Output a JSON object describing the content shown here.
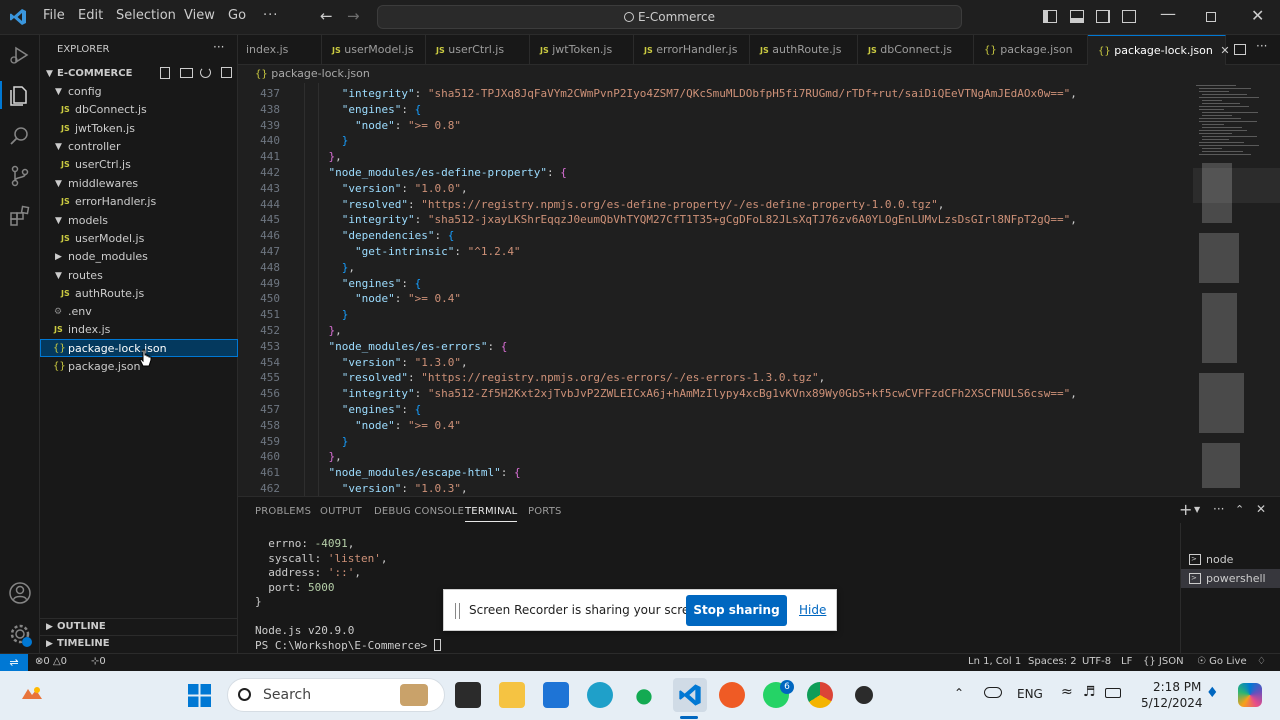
{
  "menu": {
    "file": "File",
    "edit": "Edit",
    "selection": "Selection",
    "view": "View",
    "go": "Go",
    "more": "···"
  },
  "command_center": {
    "label": "E-Commerce"
  },
  "explorer": {
    "title": "EXPLORER",
    "project": "E-COMMERCE",
    "items": [
      {
        "label": "config",
        "type": "folder"
      },
      {
        "label": "dbConnect.js",
        "type": "js"
      },
      {
        "label": "jwtToken.js",
        "type": "js"
      },
      {
        "label": "controller",
        "type": "folder"
      },
      {
        "label": "userCtrl.js",
        "type": "js"
      },
      {
        "label": "middlewares",
        "type": "folder"
      },
      {
        "label": "errorHandler.js",
        "type": "js"
      },
      {
        "label": "models",
        "type": "folder"
      },
      {
        "label": "userModel.js",
        "type": "js"
      },
      {
        "label": "node_modules",
        "type": "folder"
      },
      {
        "label": "routes",
        "type": "folder"
      },
      {
        "label": "authRoute.js",
        "type": "js"
      },
      {
        "label": ".env",
        "type": "env"
      },
      {
        "label": "index.js",
        "type": "js"
      },
      {
        "label": "package-lock.json",
        "type": "json"
      },
      {
        "label": "package.json",
        "type": "json"
      }
    ],
    "outline": "OUTLINE",
    "timeline": "TIMELINE"
  },
  "tabs": [
    {
      "label": "index.js",
      "icon": "JS"
    },
    {
      "label": "userModel.js",
      "icon": "JS"
    },
    {
      "label": "userCtrl.js",
      "icon": "JS"
    },
    {
      "label": "jwtToken.js",
      "icon": "JS"
    },
    {
      "label": "errorHandler.js",
      "icon": "JS"
    },
    {
      "label": "authRoute.js",
      "icon": "JS"
    },
    {
      "label": "dbConnect.js",
      "icon": "JS"
    },
    {
      "label": "package.json",
      "icon": "{}"
    },
    {
      "label": "package-lock.json",
      "icon": "{}"
    }
  ],
  "breadcrumb": "package-lock.json",
  "editor_lines": [
    {
      "n": "437",
      "t": "      \"integrity\": \"sha512-TPJXq8JqFaVYm2CWmPvnP2Iyo4ZSM7/QKcSmuMLDObfpH5fi7RUGmd/rTDf+rut/saiDiQEeVTNgAmJEdAOx0w==\","
    },
    {
      "n": "438",
      "t": "      \"engines\": {"
    },
    {
      "n": "439",
      "t": "        \"node\": \">= 0.8\""
    },
    {
      "n": "440",
      "t": "      }"
    },
    {
      "n": "441",
      "t": "    },"
    },
    {
      "n": "442",
      "t": "    \"node_modules/es-define-property\": {"
    },
    {
      "n": "443",
      "t": "      \"version\": \"1.0.0\","
    },
    {
      "n": "444",
      "t": "      \"resolved\": \"https://registry.npmjs.org/es-define-property/-/es-define-property-1.0.0.tgz\","
    },
    {
      "n": "445",
      "t": "      \"integrity\": \"sha512-jxayLKShrEqqzJ0eumQbVhTYQM27CfT1T35+gCgDFoL82JLsXqTJ76zv6A0YLOgEnLUMvLzsDsGIrl8NFpT2gQ==\","
    },
    {
      "n": "446",
      "t": "      \"dependencies\": {"
    },
    {
      "n": "447",
      "t": "        \"get-intrinsic\": \"^1.2.4\""
    },
    {
      "n": "448",
      "t": "      },"
    },
    {
      "n": "449",
      "t": "      \"engines\": {"
    },
    {
      "n": "450",
      "t": "        \"node\": \">= 0.4\""
    },
    {
      "n": "451",
      "t": "      }"
    },
    {
      "n": "452",
      "t": "    },"
    },
    {
      "n": "453",
      "t": "    \"node_modules/es-errors\": {"
    },
    {
      "n": "454",
      "t": "      \"version\": \"1.3.0\","
    },
    {
      "n": "455",
      "t": "      \"resolved\": \"https://registry.npmjs.org/es-errors/-/es-errors-1.3.0.tgz\","
    },
    {
      "n": "456",
      "t": "      \"integrity\": \"sha512-Zf5H2Kxt2xjTvbJvP2ZWLEICxA6j+hAmMzIlypy4xcBg1vKVnx89Wy0GbS+kf5cwCVFFzdCFh2XSCFNULS6csw==\","
    },
    {
      "n": "457",
      "t": "      \"engines\": {"
    },
    {
      "n": "458",
      "t": "        \"node\": \">= 0.4\""
    },
    {
      "n": "459",
      "t": "      }"
    },
    {
      "n": "460",
      "t": "    },"
    },
    {
      "n": "461",
      "t": "    \"node_modules/escape-html\": {"
    },
    {
      "n": "462",
      "t": "      \"version\": \"1.0.3\","
    }
  ],
  "panel": {
    "tabs": [
      "PROBLEMS",
      "OUTPUT",
      "DEBUG CONSOLE",
      "TERMINAL",
      "PORTS"
    ],
    "terminal_lines": [
      {
        "label": "  errno: ",
        "value": "-4091",
        "end": ",",
        "kind": "num"
      },
      {
        "label": "  syscall: ",
        "value": "'listen'",
        "end": ",",
        "kind": "str"
      },
      {
        "label": "  address: ",
        "value": "'::'",
        "end": ",",
        "kind": "str"
      },
      {
        "label": "  port: ",
        "value": "5000",
        "end": "",
        "kind": "num"
      },
      {
        "label": "}",
        "value": "",
        "end": "",
        "kind": "plain"
      },
      {
        "label": "",
        "value": "",
        "end": "",
        "kind": "plain"
      },
      {
        "label": "Node.js v20.9.0",
        "value": "",
        "end": "",
        "kind": "plain"
      },
      {
        "label": "PS C:\\Workshop\\E-Commerce> ",
        "value": "",
        "end": "",
        "kind": "plain"
      }
    ],
    "terminals": [
      "node",
      "powershell"
    ]
  },
  "share_bar": {
    "message": "Screen Recorder is sharing your screen.",
    "stop": "Stop sharing",
    "hide": "Hide"
  },
  "status": {
    "problems_errors": "0",
    "problems_warnings": "0",
    "ports": "0",
    "position": "Ln 1, Col 1",
    "spaces": "Spaces: 2",
    "encoding": "UTF-8",
    "eol": "LF",
    "language": "JSON",
    "golive": "Go Live"
  },
  "taskbar": {
    "search": "Search",
    "lang": "ENG",
    "time": "2:18 PM",
    "date": "5/12/2024",
    "whatsapp_badge": "6"
  },
  "colors": {
    "accent": "#0078d4",
    "stop_button": "#0067c0",
    "statusbar_remote": "#0078d4"
  }
}
